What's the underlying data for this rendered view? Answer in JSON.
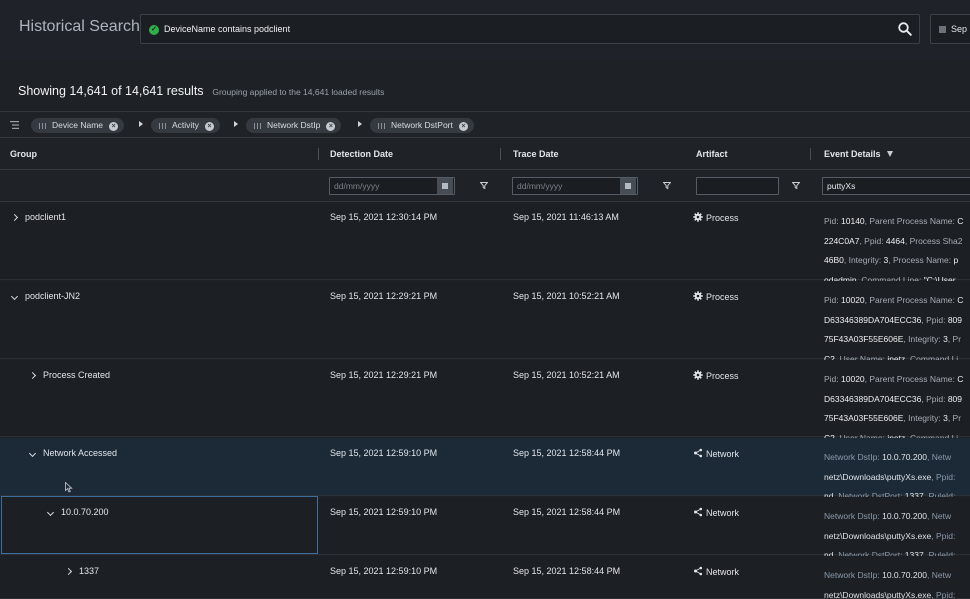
{
  "header": {
    "title": "Historical Search",
    "search_query": "DeviceName contains podclient",
    "date_chip": "Sep"
  },
  "summary": {
    "showing": "Showing 14,641 of 14,641 results",
    "grouping_note": "Grouping applied to the 14,641 loaded results"
  },
  "grouping": {
    "chips": [
      "Device Name",
      "Activity",
      "Network DstIp",
      "Network DstPort"
    ]
  },
  "columns": {
    "group": "Group",
    "detection_date": "Detection Date",
    "trace_date": "Trace Date",
    "artifact": "Artifact",
    "event_details": "Event Details"
  },
  "filters": {
    "detection_date_placeholder": "dd/mm/yyyy",
    "trace_date_placeholder": "dd/mm/yyyy",
    "artifact_value": "",
    "event_details_value": "puttyXs"
  },
  "rows": [
    {
      "group": "podclient1",
      "expanded": false,
      "detection": "Sep 15, 2021 12:30:14 PM",
      "trace": "Sep 15, 2021 11:46:13 AM",
      "artifact": "Process",
      "details": [
        [
          {
            "k": "Pid: "
          },
          {
            "v": "10140"
          },
          {
            "k": ", Parent Process Name: "
          },
          {
            "v": "C"
          }
        ],
        [
          {
            "v": "224C0A7"
          },
          {
            "k": ", Ppid: "
          },
          {
            "v": "4464"
          },
          {
            "k": ", Process Sha2"
          }
        ],
        [
          {
            "v": "46B0"
          },
          {
            "k": ", Integrity: "
          },
          {
            "v": "3"
          },
          {
            "k": ", Process Name: "
          },
          {
            "v": "p"
          }
        ],
        [
          {
            "v": "odadmin"
          },
          {
            "k": ", Command Line: "
          },
          {
            "v": "\"C:\\User"
          }
        ]
      ]
    },
    {
      "group": "podclient-JN2",
      "expanded": true,
      "detection": "Sep 15, 2021 12:29:21 PM",
      "trace": "Sep 15, 2021 10:52:21 AM",
      "artifact": "Process",
      "details": [
        [
          {
            "k": "Pid: "
          },
          {
            "v": "10020"
          },
          {
            "k": ", Parent Process Name: "
          },
          {
            "v": "C"
          }
        ],
        [
          {
            "v": "D63346389DA704ECC36"
          },
          {
            "k": ", Ppid: "
          },
          {
            "v": "809"
          }
        ],
        [
          {
            "v": "75F43A03F55E606E"
          },
          {
            "k": ", Integrity: "
          },
          {
            "v": "3"
          },
          {
            "k": ", Pr"
          }
        ],
        [
          {
            "v": "C2"
          },
          {
            "k": ", User Name: "
          },
          {
            "v": "jnetz"
          },
          {
            "k": ", Command Li"
          }
        ]
      ]
    },
    {
      "group": "Process Created",
      "expanded": false,
      "detection": "Sep 15, 2021 12:29:21 PM",
      "trace": "Sep 15, 2021 10:52:21 AM",
      "artifact": "Process",
      "details": [
        [
          {
            "k": "Pid: "
          },
          {
            "v": "10020"
          },
          {
            "k": ", Parent Process Name: "
          },
          {
            "v": "C"
          }
        ],
        [
          {
            "v": "D63346389DA704ECC36"
          },
          {
            "k": ", Ppid: "
          },
          {
            "v": "809"
          }
        ],
        [
          {
            "v": "75F43A03F55E606E"
          },
          {
            "k": ", Integrity: "
          },
          {
            "v": "3"
          },
          {
            "k": ", Pr"
          }
        ],
        [
          {
            "v": "C2"
          },
          {
            "k": ", User Name: "
          },
          {
            "v": "jnetz"
          },
          {
            "k": ", Command Li"
          }
        ]
      ]
    },
    {
      "group": "Network Accessed",
      "expanded": true,
      "detection": "Sep 15, 2021 12:59:10 PM",
      "trace": "Sep 15, 2021 12:58:44 PM",
      "artifact": "Network",
      "details": [
        [
          {
            "k": "Network DstIp: "
          },
          {
            "v": "10.0.70.200"
          },
          {
            "k": ", Netw"
          }
        ],
        [
          {
            "v": "netz\\Downloads\\puttyXs.exe"
          },
          {
            "k": ", Ppid:"
          }
        ],
        [
          {
            "v": "nd"
          },
          {
            "k": ", Network DstPort: "
          },
          {
            "v": "1337"
          },
          {
            "k": ", RuleId:"
          }
        ]
      ]
    },
    {
      "group": "10.0.70.200",
      "expanded": true,
      "detection": "Sep 15, 2021 12:59:10 PM",
      "trace": "Sep 15, 2021 12:58:44 PM",
      "artifact": "Network",
      "details": [
        [
          {
            "k": "Network DstIp: "
          },
          {
            "v": "10.0.70.200"
          },
          {
            "k": ", Netw"
          }
        ],
        [
          {
            "v": "netz\\Downloads\\puttyXs.exe"
          },
          {
            "k": ", Ppid:"
          }
        ],
        [
          {
            "v": "nd"
          },
          {
            "k": ", Network DstPort: "
          },
          {
            "v": "1337"
          },
          {
            "k": ", RuleId:"
          }
        ]
      ]
    },
    {
      "group": "1337",
      "expanded": false,
      "detection": "Sep 15, 2021 12:59:10 PM",
      "trace": "Sep 15, 2021 12:58:44 PM",
      "artifact": "Network",
      "details": [
        [
          {
            "k": "Network DstIp: "
          },
          {
            "v": "10.0.70.200"
          },
          {
            "k": ", Netw"
          }
        ],
        [
          {
            "v": "netz\\Downloads\\puttyXs.exe"
          },
          {
            "k": ", Ppid:"
          }
        ]
      ]
    }
  ]
}
